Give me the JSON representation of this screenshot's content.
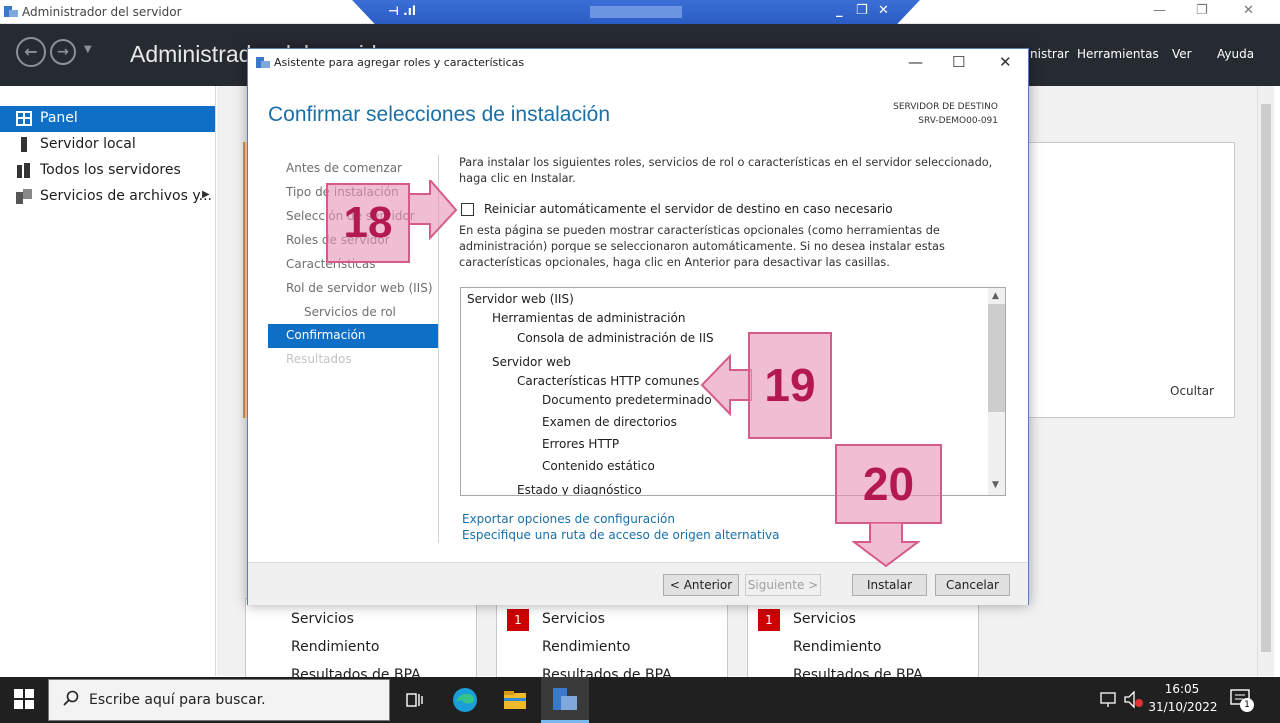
{
  "window": {
    "title": "Administrador del servidor"
  },
  "header": {
    "app_title": "Administrador del servidor",
    "menu": [
      "nistrar",
      "Herramientas",
      "Ver",
      "Ayuda"
    ]
  },
  "sidebar": {
    "items": [
      {
        "label": "Panel",
        "icon": "dashboard-icon",
        "active": true
      },
      {
        "label": "Servidor local",
        "icon": "server-icon"
      },
      {
        "label": "Todos los servidores",
        "icon": "servers-icon"
      },
      {
        "label": "Servicios de archivos y...",
        "icon": "file-services-icon"
      }
    ]
  },
  "background": {
    "hide_label": "Ocultar",
    "cards": [
      {
        "rows": [
          "Servicios",
          "Rendimiento",
          "Resultados de BPA"
        ],
        "badge": ""
      },
      {
        "rows": [
          "Servicios",
          "Rendimiento",
          "Resultados de BPA"
        ],
        "badge": "1"
      },
      {
        "rows": [
          "Servicios",
          "Rendimiento",
          "Resultados de BPA"
        ],
        "badge": "1"
      }
    ]
  },
  "dialog": {
    "title": "Asistente para agregar roles y características",
    "page_title": "Confirmar selecciones de instalación",
    "destination_label": "SERVIDOR DE DESTINO",
    "destination_value": "SRV-DEMO00-091",
    "steps": [
      {
        "label": "Antes de comenzar",
        "state": "normal"
      },
      {
        "label": "Tipo de instalación",
        "state": "normal"
      },
      {
        "label": "Selección de servidor",
        "state": "normal"
      },
      {
        "label": "Roles de servidor",
        "state": "normal"
      },
      {
        "label": "Características",
        "state": "normal"
      },
      {
        "label": "Rol de servidor web (IIS)",
        "state": "normal"
      },
      {
        "label": "Servicios de rol",
        "state": "sub"
      },
      {
        "label": "Confirmación",
        "state": "active"
      },
      {
        "label": "Resultados",
        "state": "disabled"
      }
    ],
    "intro": "Para instalar los siguientes roles, servicios de rol o características en el servidor seleccionado, haga clic en Instalar.",
    "restart_checkbox": {
      "label": "Reiniciar automáticamente el servidor de destino en caso necesario",
      "checked": false
    },
    "note": "En esta página se pueden mostrar características opcionales (como herramientas de administración) porque se seleccionaron automáticamente. Si no desea instalar estas características opcionales, haga clic en Anterior para desactivar las casillas.",
    "selections": [
      {
        "text": "Servidor web (IIS)",
        "level": 0
      },
      {
        "text": "Herramientas de administración",
        "level": 1
      },
      {
        "text": "Consola de administración de IIS",
        "level": 2
      },
      {
        "text": "Servidor web",
        "level": 1
      },
      {
        "text": "Características HTTP comunes",
        "level": 2
      },
      {
        "text": "Documento predeterminado",
        "level": 3
      },
      {
        "text": "Examen de directorios",
        "level": 3
      },
      {
        "text": "Errores HTTP",
        "level": 3
      },
      {
        "text": "Contenido estático",
        "level": 3
      },
      {
        "text": "Estado y diagnóstico",
        "level": 2
      }
    ],
    "links": [
      "Exportar opciones de configuración",
      "Especifique una ruta de acceso de origen alternativa"
    ],
    "buttons": {
      "previous": "< Anterior",
      "next": "Siguiente >",
      "install": "Instalar",
      "cancel": "Cancelar"
    }
  },
  "annotations": [
    "18",
    "19",
    "20"
  ],
  "taskbar": {
    "search_placeholder": "Escribe aquí para buscar.",
    "time": "16:05",
    "date": "31/10/2022",
    "notification_count": "1"
  },
  "colors": {
    "accent": "#0f6fc6",
    "title_blue": "#1a6fa8",
    "header_dark": "#262a31",
    "callout_pink": "#e896b4"
  }
}
